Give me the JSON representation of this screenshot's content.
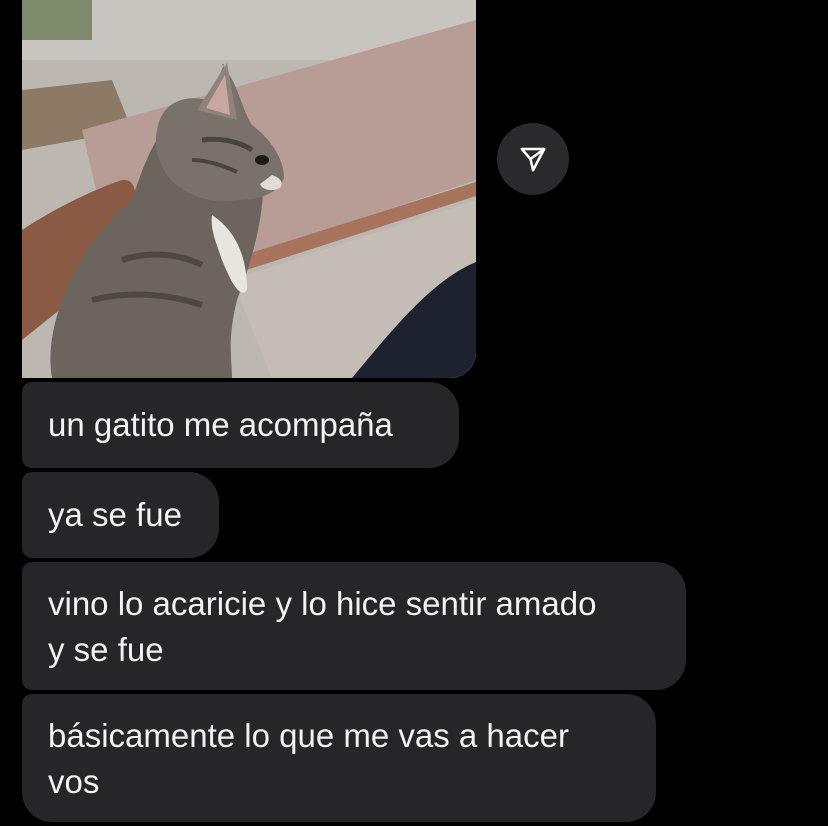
{
  "thread": {
    "messages": [
      {
        "text": "un gatito me acompaña"
      },
      {
        "text": "ya se fue"
      },
      {
        "text": "vino lo acaricie y lo hice sentir amado\ny se fue"
      },
      {
        "text": "básicamente lo que me vas a hacer\nvos"
      }
    ]
  },
  "photo": {
    "subject_icon": "cat-photo"
  },
  "share": {
    "icon": "send-arrow-icon"
  },
  "colors": {
    "background": "#000000",
    "bubble": "#262628",
    "text": "#f2f2f2",
    "share_button": "#2a2a2c"
  }
}
